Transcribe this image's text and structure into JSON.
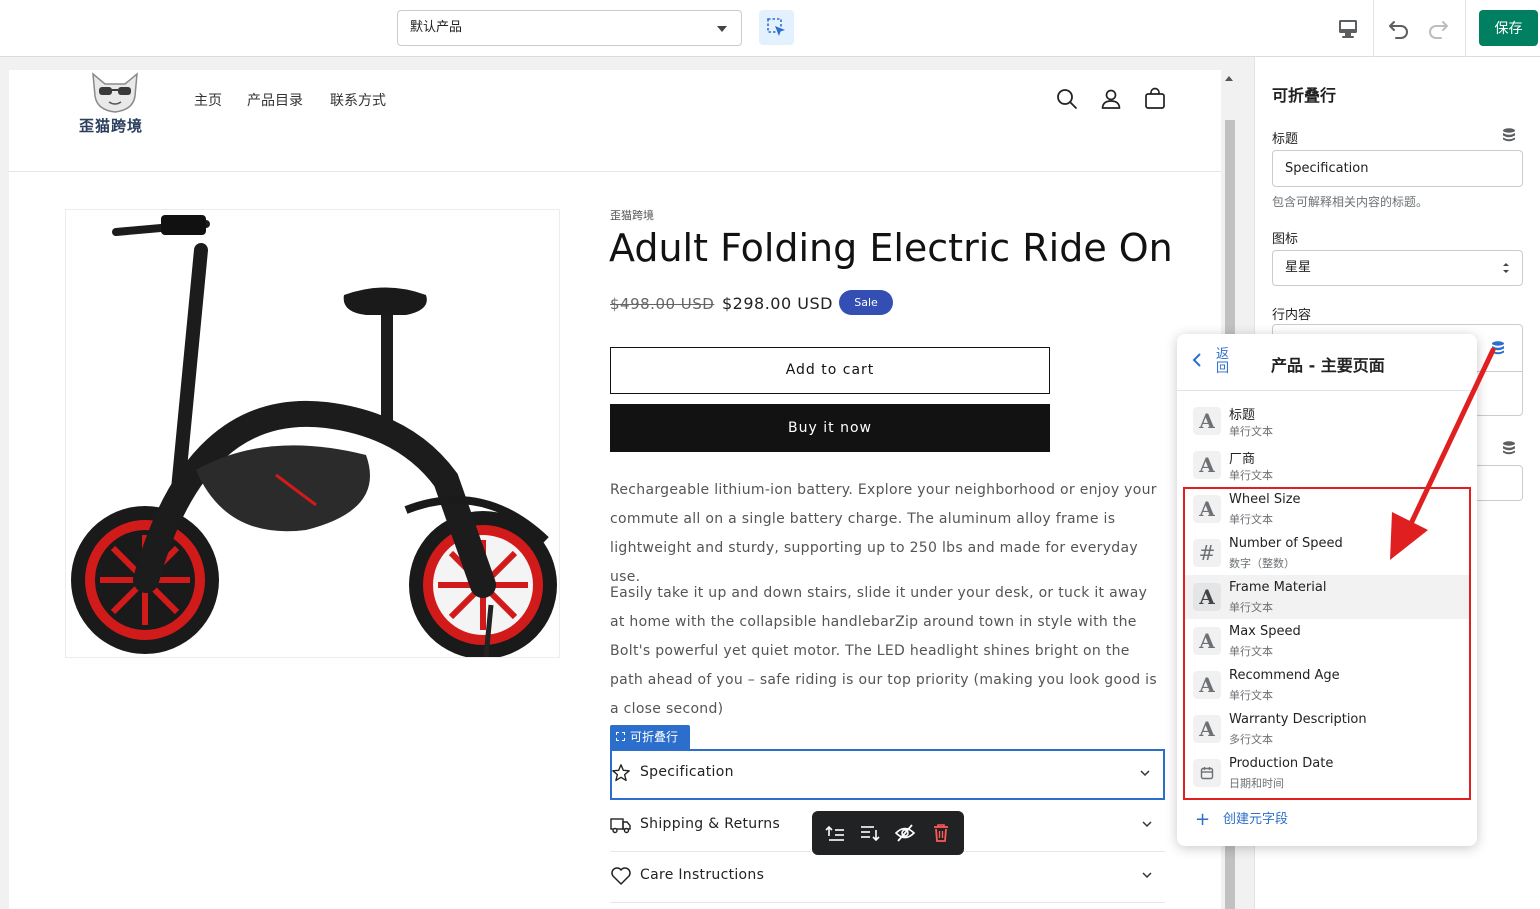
{
  "toolbar": {
    "template_select": "默认产品",
    "save_label": "保存"
  },
  "store": {
    "logo_text": "歪猫跨境",
    "nav": [
      "主页",
      "产品目录",
      "联系方式"
    ]
  },
  "product": {
    "vendor": "歪猫跨境",
    "title": "Adult Folding Electric Ride On",
    "price_old": "$498.00 USD",
    "price_new": "$298.00 USD",
    "sale_badge": "Sale",
    "add_to_cart": "Add to cart",
    "buy_now": "Buy it now",
    "description": [
      "Rechargeable lithium-ion battery. Explore your neighborhood or enjoy your commute all on a single battery charge. The aluminum alloy frame is lightweight and sturdy, supporting up to 250 lbs and made for everyday use.",
      "Easily take it up and down stairs, slide it under your desk, or tuck it away at home with the collapsible handlebarZip around town in style with the Bolt's powerful yet quiet motor.  The LED headlight shines bright on the path ahead of you – safe riding is our top priority (making you look good is a close second)"
    ],
    "section_tag": "可折叠行",
    "accordions": [
      "Specification",
      "Shipping & Returns",
      "Care Instructions"
    ]
  },
  "settings": {
    "title": "可折叠行",
    "heading_label": "标题",
    "heading_value": "Specification",
    "heading_help": "包含可解释相关内容的标题。",
    "icon_label": "图标",
    "icon_value": "星星",
    "content_label": "行内容"
  },
  "popover": {
    "back_label": "返回",
    "title": "产品 - 主要页面",
    "items": [
      {
        "icon": "A",
        "name": "标题",
        "type": "单行文本"
      },
      {
        "icon": "A",
        "name": "厂商",
        "type": "单行文本"
      },
      {
        "icon": "A",
        "name": "Wheel Size",
        "type": "单行文本"
      },
      {
        "icon": "#",
        "name": "Number of Speed",
        "type": "数字（整数）"
      },
      {
        "icon": "A",
        "name": "Frame Material",
        "type": "单行文本"
      },
      {
        "icon": "A",
        "name": "Max Speed",
        "type": "单行文本"
      },
      {
        "icon": "A",
        "name": "Recommend Age",
        "type": "单行文本"
      },
      {
        "icon": "A",
        "name": "Warranty Description",
        "type": "多行文本"
      },
      {
        "icon": "calendar-icon",
        "name": "Production Date",
        "type": "日期和时间"
      }
    ],
    "create_label": "创建元字段"
  },
  "colors": {
    "save": "#008060",
    "accent": "#2c6ecb",
    "sale": "#334fb4",
    "highlight": "#e02020"
  }
}
